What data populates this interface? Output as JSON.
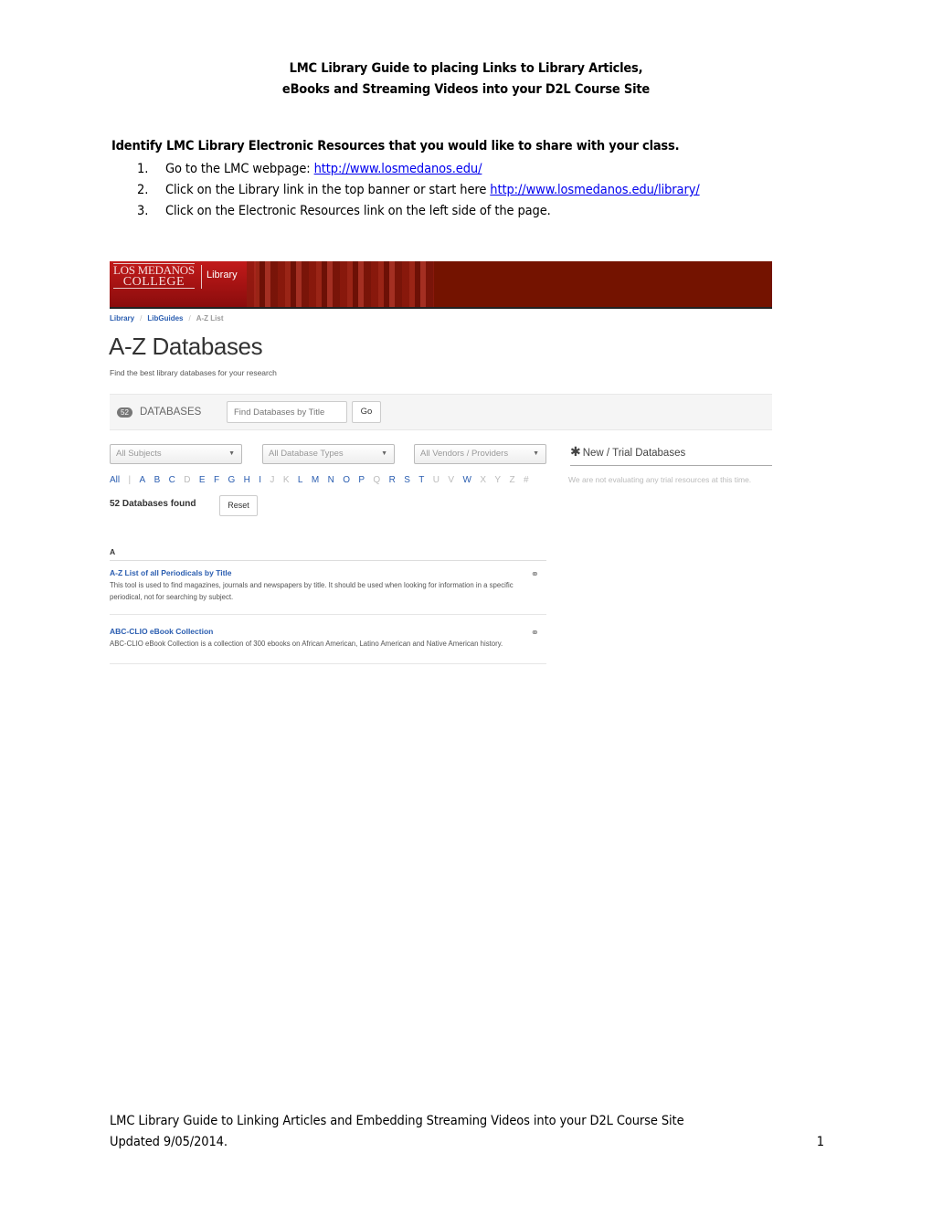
{
  "document": {
    "title_line1": "LMC Library Guide to placing Links to Library Articles,",
    "title_line2": "eBooks and Streaming Videos into your D2L Course Site",
    "intro": "Identify LMC Library Electronic Resources that you would like to share with your class.",
    "steps": [
      {
        "num": "1.",
        "text": "Go to the LMC webpage: ",
        "link": "http://www.losmedanos.edu/"
      },
      {
        "num": "2.",
        "text": "Click on the Library link in the top banner or start here ",
        "link": "http://www.losmedanos.edu/library/"
      },
      {
        "num": "3.",
        "text": "Click on the Electronic Resources link on the left side of the page.",
        "link": ""
      }
    ],
    "footer_line1": "LMC Library Guide to Linking Articles and Embedding Streaming Videos into your D2L Course Site",
    "footer_line2": "Updated 9/05/2014.",
    "page_number": "1"
  },
  "screenshot": {
    "banner": {
      "logo_line1": "LOS MEDANOS",
      "logo_line2": "COLLEGE",
      "section": "Library",
      "color": "#741300"
    },
    "breadcrumb": [
      "Library",
      "LibGuides",
      "A-Z List"
    ],
    "heading": "A-Z Databases",
    "subheading": "Find the best library databases for your research",
    "count_badge": "52",
    "count_label": "DATABASES",
    "search_placeholder": "Find Databases by Title",
    "go_label": "Go",
    "filters": [
      "All Subjects",
      "All Database Types",
      "All Vendors / Providers"
    ],
    "letters": [
      {
        "l": "All",
        "on": true
      },
      {
        "l": "|",
        "on": false
      },
      {
        "l": "A",
        "on": true
      },
      {
        "l": "B",
        "on": true
      },
      {
        "l": "C",
        "on": true
      },
      {
        "l": "D",
        "on": false
      },
      {
        "l": "E",
        "on": true
      },
      {
        "l": "F",
        "on": true
      },
      {
        "l": "G",
        "on": true
      },
      {
        "l": "H",
        "on": true
      },
      {
        "l": "I",
        "on": true
      },
      {
        "l": "J",
        "on": false
      },
      {
        "l": "K",
        "on": false
      },
      {
        "l": "L",
        "on": true
      },
      {
        "l": "M",
        "on": true
      },
      {
        "l": "N",
        "on": true
      },
      {
        "l": "O",
        "on": true
      },
      {
        "l": "P",
        "on": true
      },
      {
        "l": "Q",
        "on": false
      },
      {
        "l": "R",
        "on": true
      },
      {
        "l": "S",
        "on": true
      },
      {
        "l": "T",
        "on": true
      },
      {
        "l": "U",
        "on": false
      },
      {
        "l": "V",
        "on": false
      },
      {
        "l": "W",
        "on": true
      },
      {
        "l": "X",
        "on": false
      },
      {
        "l": "Y",
        "on": false
      },
      {
        "l": "Z",
        "on": false
      },
      {
        "l": "#",
        "on": false
      }
    ],
    "found_label": "52 Databases found",
    "reset_label": "Reset",
    "trial_heading": "New / Trial Databases",
    "trial_text": "We are not evaluating any trial resources at this time.",
    "section_letter": "A",
    "entries": [
      {
        "title": "A-Z List of all Periodicals by Title",
        "desc": "This tool is used to find magazines, journals and newspapers by title. It should be used when looking for information in a specific periodical, not for searching by subject."
      },
      {
        "title": "ABC-CLIO eBook Collection",
        "desc": "ABC-CLIO eBook Collection is a collection of 300 ebooks on African American, Latino American and Native American history."
      }
    ]
  }
}
